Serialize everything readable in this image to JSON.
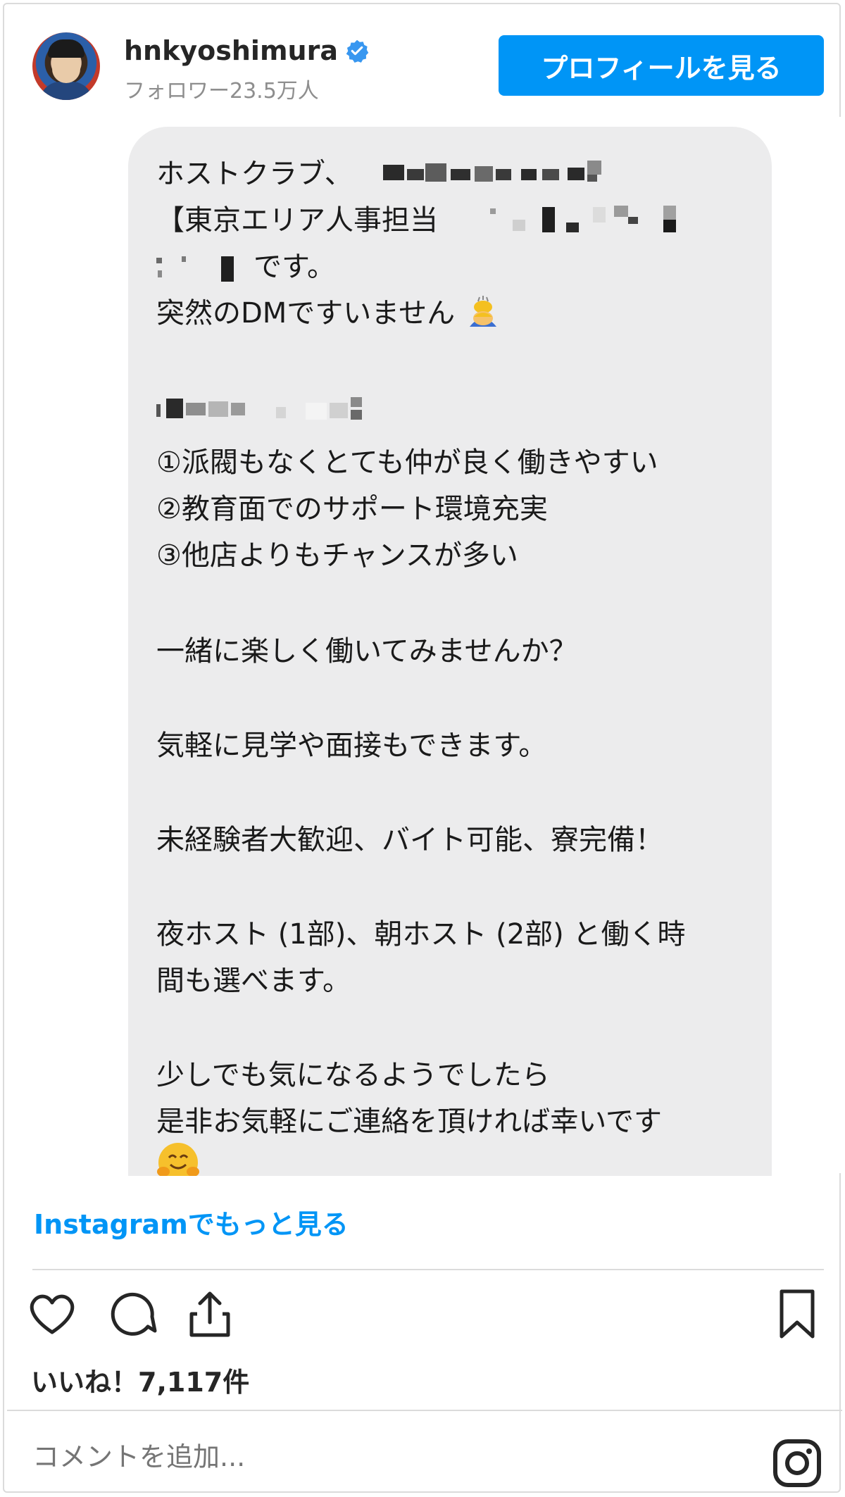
{
  "header": {
    "username": "hnkyoshimura",
    "followers": "フォロワー23.5万人",
    "profile_button": "プロフィールを見る",
    "verified": true
  },
  "dm": {
    "line1": "ホストクラブ、",
    "line2": "【東京エリア人事担当",
    "line3": "です。",
    "line4": "突然のDMですいません",
    "point1": "①派閥もなくとても仲が良く働きやすい",
    "point2": "②教育面でのサポート環境充実",
    "point3": "③他店よりもチャンスが多い",
    "invite": "一緒に楽しく働いてみませんか？",
    "visit": "気軽に見学や面接もできます。",
    "welcome": "未経験者大歓迎、バイト可能、寮完備！",
    "shift1": "夜ホスト (1部)、朝ホスト (2部) と働く時",
    "shift2": "間も選べます。",
    "contact1": "少しでも気になるようでしたら",
    "contact2": "是非お気軽にご連絡を頂ければ幸いです"
  },
  "more_link": "Instagramでもっと見る",
  "actions": {
    "like_icon": "heart-icon",
    "comment_icon": "comment-icon",
    "share_icon": "share-icon",
    "save_icon": "bookmark-icon"
  },
  "likes": "いいね！7,117件",
  "comment": {
    "placeholder": "コメントを追加..."
  },
  "colors": {
    "accent": "#0095f6",
    "bubble": "#ececed",
    "muted": "#8e8e8e"
  }
}
